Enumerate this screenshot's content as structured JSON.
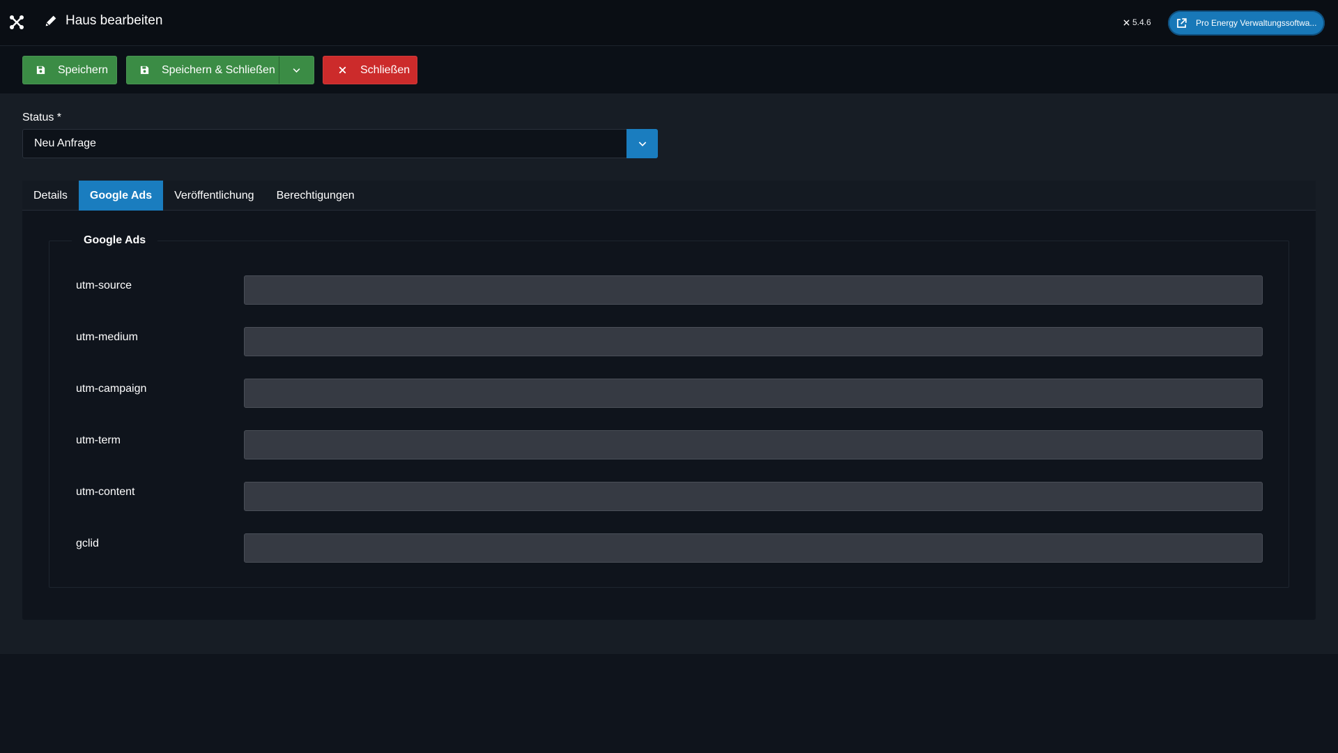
{
  "header": {
    "title": "Haus bearbeiten",
    "version": "5.4.6",
    "site_button": "Pro Energy Verwaltungssoftwa..."
  },
  "toolbar": {
    "save_label": "Speichern",
    "save_close_label": "Speichern & Schließen",
    "close_label": "Schließen"
  },
  "status": {
    "label": "Status *",
    "value": "Neu Anfrage"
  },
  "tabs": [
    {
      "label": "Details",
      "active": false
    },
    {
      "label": "Google Ads",
      "active": true
    },
    {
      "label": "Veröffentlichung",
      "active": false
    },
    {
      "label": "Berechtigungen",
      "active": false
    }
  ],
  "fieldset": {
    "legend": "Google Ads",
    "fields": [
      {
        "label": "utm-source",
        "value": ""
      },
      {
        "label": "utm-medium",
        "value": ""
      },
      {
        "label": "utm-campaign",
        "value": ""
      },
      {
        "label": "utm-term",
        "value": ""
      },
      {
        "label": "utm-content",
        "value": ""
      },
      {
        "label": "gclid",
        "value": ""
      }
    ]
  },
  "colors": {
    "accent": "#1a7dbf",
    "success": "#3b8c45",
    "danger": "#cc2b2b"
  }
}
